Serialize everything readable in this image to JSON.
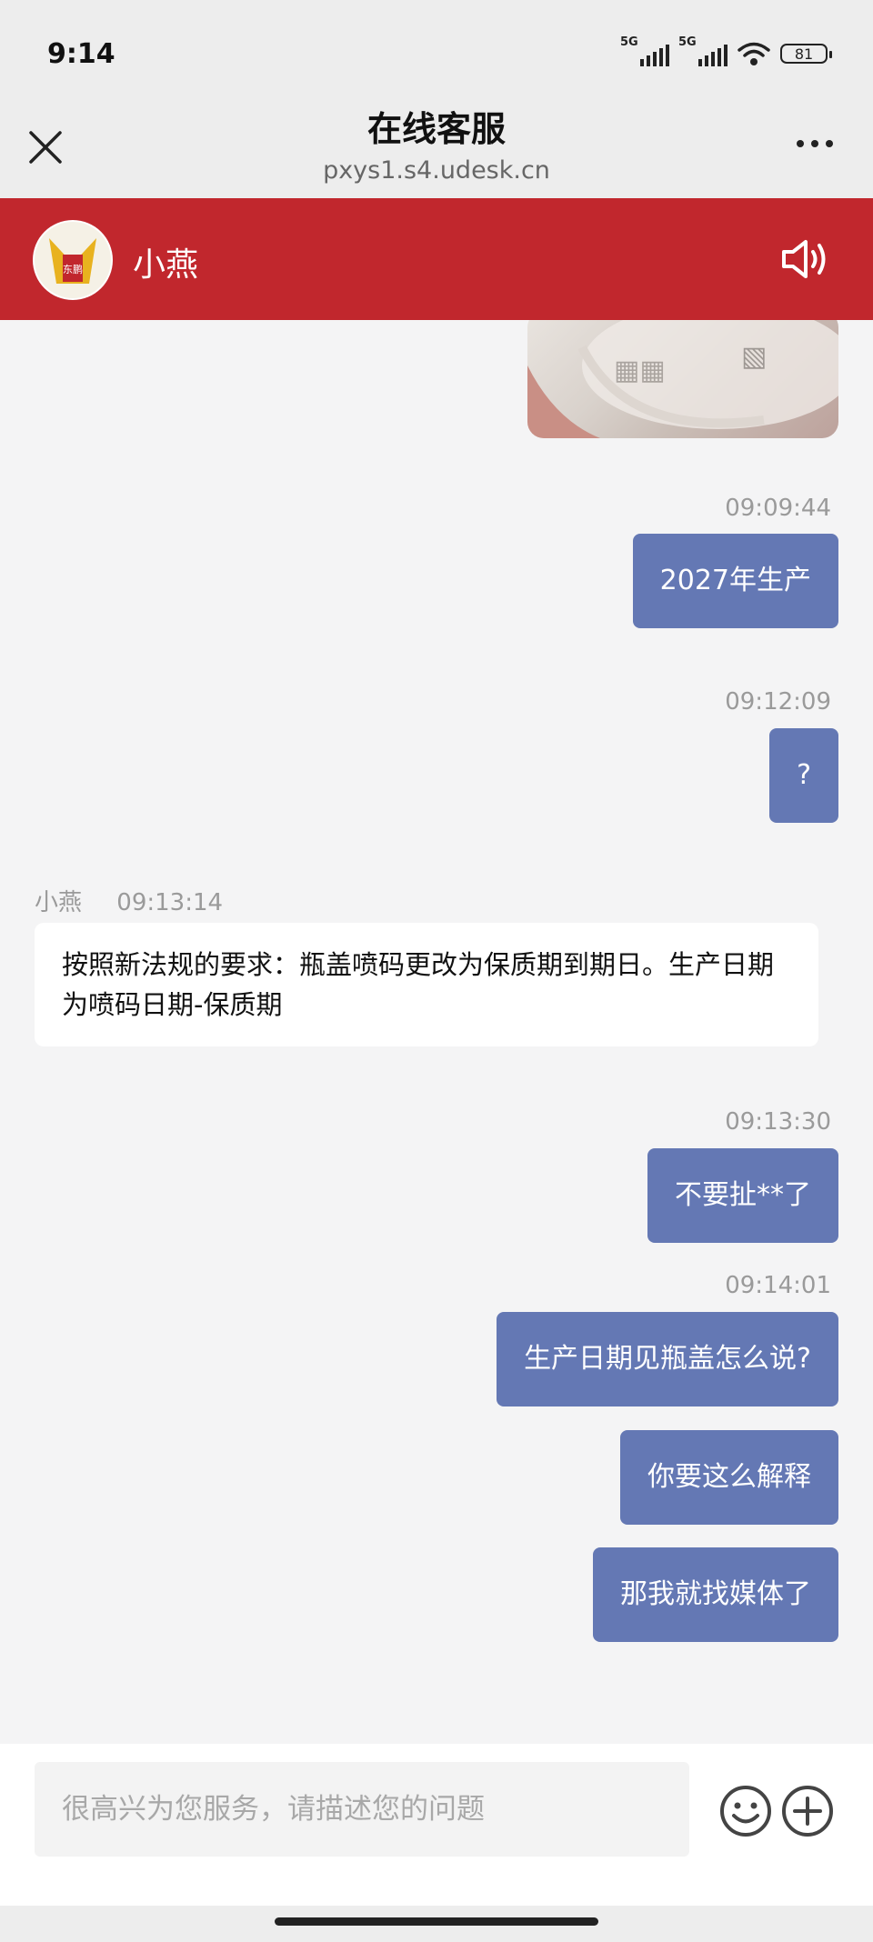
{
  "status_bar": {
    "time": "9:14",
    "signal1_tag": "5G",
    "signal2_tag": "5G",
    "battery": "81"
  },
  "nav": {
    "title": "在线客服",
    "subtitle": "pxys1.s4.udesk.cn"
  },
  "agent": {
    "name": "小燕",
    "avatar_text": "东鹏"
  },
  "messages": [
    {
      "from": "me",
      "time": "09:09:44",
      "text": "2027年生产"
    },
    {
      "from": "me",
      "time": "09:12:09",
      "text": "?"
    },
    {
      "from": "agent",
      "name": "小燕",
      "time": "09:13:14",
      "text": "按照新法规的要求：瓶盖喷码更改为保质期到期日。生产日期为喷码日期-保质期"
    },
    {
      "from": "me",
      "time": "09:13:30",
      "text": "不要扯**了"
    },
    {
      "from": "me",
      "time": "09:14:01",
      "text": "生产日期见瓶盖怎么说?"
    },
    {
      "from": "me",
      "time": "",
      "text": "你要这么解释"
    },
    {
      "from": "me",
      "time": "",
      "text": "那我就找媒体了"
    }
  ],
  "input": {
    "placeholder": "很高兴为您服务，请描述您的问题",
    "value": ""
  },
  "colors": {
    "agent_bar": "#c1272d",
    "my_bubble": "#6478b4",
    "background": "#f4f4f5"
  },
  "icons": [
    "close-icon",
    "more-icon",
    "speaker-icon",
    "emoji-icon",
    "plus-icon"
  ]
}
